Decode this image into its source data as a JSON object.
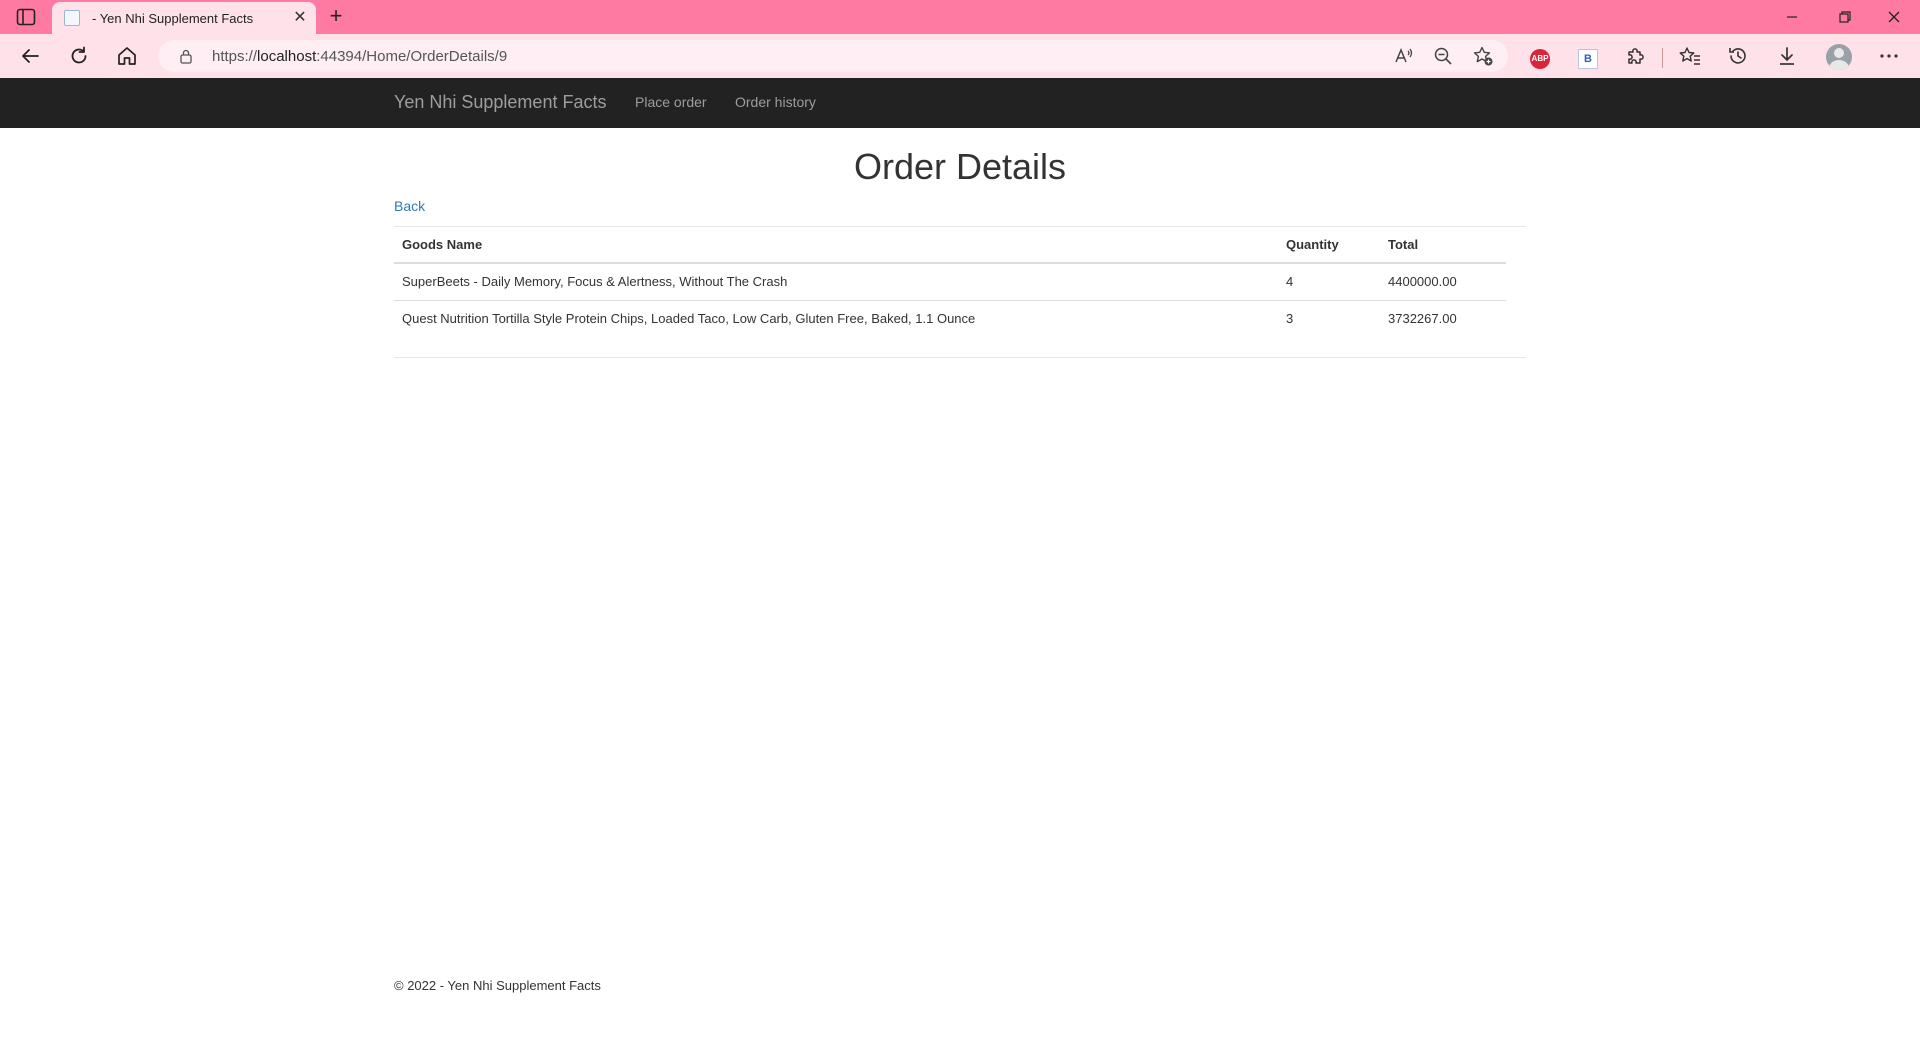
{
  "browser": {
    "tab_title": "- Yen Nhi Supplement Facts",
    "url_prefix": "https://",
    "url_host": "localhost",
    "url_path": ":44394/Home/OrderDetails/9",
    "extensions": {
      "abp_label": "ABP",
      "b_label": "B"
    },
    "icons": [
      "sidebar-toggle-icon",
      "page-favicon-icon",
      "close-icon",
      "plus-icon",
      "minimize-icon",
      "restore-icon",
      "back-arrow-icon",
      "refresh-icon",
      "home-icon",
      "lock-icon",
      "read-aloud-icon",
      "zoom-out-icon",
      "add-favorite-icon",
      "puzzle-icon",
      "favorites-icon",
      "history-icon",
      "download-icon",
      "profile-icon",
      "more-icon"
    ]
  },
  "navbar": {
    "brand": "Yen Nhi Supplement Facts",
    "links": [
      {
        "label": "Place order"
      },
      {
        "label": "Order history"
      }
    ]
  },
  "main": {
    "title": "Order Details",
    "back_label": "Back",
    "table": {
      "headers": [
        "Goods Name",
        "Quantity",
        "Total"
      ],
      "rows": [
        {
          "name": "SuperBeets - Daily Memory, Focus & Alertness, Without The Crash",
          "quantity": "4",
          "total": "4400000.00"
        },
        {
          "name": "Quest Nutrition Tortilla Style Protein Chips, Loaded Taco, Low Carb, Gluten Free, Baked, 1.1 Ounce",
          "quantity": "3",
          "total": "3732267.00"
        }
      ]
    }
  },
  "footer": {
    "text": "© 2022 - Yen Nhi Supplement Facts"
  },
  "colors": {
    "tabbar": "#ff7aa3",
    "toolbar": "#ffe1ea",
    "navbar": "#222222",
    "link": "#337ab7"
  }
}
